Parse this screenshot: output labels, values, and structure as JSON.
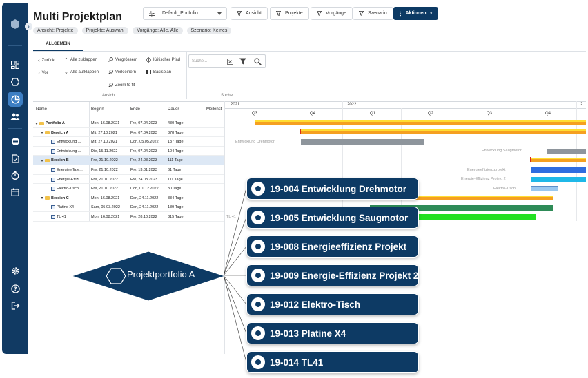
{
  "header": {
    "title": "Multi Projektplan",
    "portfolio_select": "Default_Portfolio",
    "buttons": {
      "ansicht": "Ansicht",
      "projekte": "Projekte",
      "vorgaenge": "Vorgänge",
      "szenario": "Szenario",
      "aktionen": "Aktionen"
    },
    "chips": [
      "Ansicht: Projekte",
      "Projekte: Auswahl",
      "Vorgänge: Alle, Alle",
      "Szenario: Keines"
    ]
  },
  "tab": {
    "label": "ALLGEMEIN"
  },
  "ribbon": {
    "zurueck": "Zurück",
    "vor": "Vor",
    "alle_zuklappen": "Alle zuklappen",
    "alle_aufklappen": "Alle aufklappen",
    "vergroessern": "Vergrössern",
    "verkleinern": "Verkleinern",
    "zoom_to_fit": "Zoom to fit",
    "kritischer_pfad": "Kritischer Pfad",
    "basisplan": "Basisplan",
    "ansicht_caption": "Ansicht",
    "search_placeholder": "Suche...",
    "suche_caption": "Suche"
  },
  "grid": {
    "columns": [
      "Name",
      "Beginn",
      "Ende",
      "Dauer",
      "Meilenst"
    ],
    "rows": [
      {
        "name": "Portfolio A",
        "start": "Mon, 16.08.2021",
        "end": "Fre, 07.04.2023",
        "duration": "430 Tage"
      },
      {
        "name": "Bereich A",
        "start": "Mit, 27.10.2021",
        "end": "Fre, 07.04.2023",
        "duration": "378 Tage"
      },
      {
        "name": "Entwicklung ...",
        "start": "Mit, 27.10.2021",
        "end": "Don, 05.05.2022",
        "duration": "137 Tage"
      },
      {
        "name": "Entwicklung ...",
        "start": "Die, 15.11.2022",
        "end": "Fre, 07.04.2023",
        "duration": "104 Tage"
      },
      {
        "name": "Bereich B",
        "start": "Fre, 21.10.2022",
        "end": "Fre, 24.03.2023",
        "duration": "111 Tage"
      },
      {
        "name": "Energieeffizie...",
        "start": "Fre, 21.10.2022",
        "end": "Fre, 13.01.2023",
        "duration": "61 Tage"
      },
      {
        "name": "Energie-Effizi...",
        "start": "Fre, 21.10.2022",
        "end": "Fre, 24.03.2023",
        "duration": "111 Tage"
      },
      {
        "name": "Elektro-Tisch",
        "start": "Fre, 21.10.2022",
        "end": "Don, 01.12.2022",
        "duration": "30 Tage"
      },
      {
        "name": "Bereich C",
        "start": "Mon, 16.08.2021",
        "end": "Don, 24.11.2022",
        "duration": "334 Tage"
      },
      {
        "name": "Platine X4",
        "start": "Sam, 05.03.2022",
        "end": "Don, 24.11.2022",
        "duration": "189 Tage"
      },
      {
        "name": "TL 41",
        "start": "Mon, 16.08.2021",
        "end": "Fre, 28.10.2022",
        "duration": "315 Tage"
      }
    ]
  },
  "gantt": {
    "years": [
      "2021",
      "2022",
      "2"
    ],
    "quarters": [
      "Q3",
      "Q4",
      "Q1",
      "Q2",
      "Q3",
      "Q4"
    ],
    "labels": {
      "entwicklung_drehmotor": "Entwicklung Drehmotor",
      "entwicklung_saugmotor": "Entwicklung Saugmotor",
      "energieeffizienzprojekt": "Energieeffizienzprojekt",
      "energie_effizienz_projekt_2": "Energie-Effizienz Projekt 2",
      "elektro_tisch": "Elektro-Tisch",
      "tl41": "TL 41"
    },
    "colors": {
      "summary": "#f5a021",
      "gray": "#8e959c",
      "blue": "#2e6de0",
      "cyan": "#1fb8e8",
      "lightblue": "#9ac8f0",
      "green_dark": "#2e8b57",
      "green": "#21e021"
    }
  },
  "overlay": {
    "portfolio_label": "Projektportfolio A",
    "projects": [
      "19-004 Entwicklung Drehmotor",
      "19-005 Entwicklung Saugmotor",
      "19-008 Energieeffizienz Projekt",
      "19-009 Energie-Effizienz Projekt 2",
      "19-012 Elektro-Tisch",
      "19-013 Platine X4",
      "19-014 TL41"
    ],
    "colors": {
      "navy": "#0d3a64"
    }
  }
}
